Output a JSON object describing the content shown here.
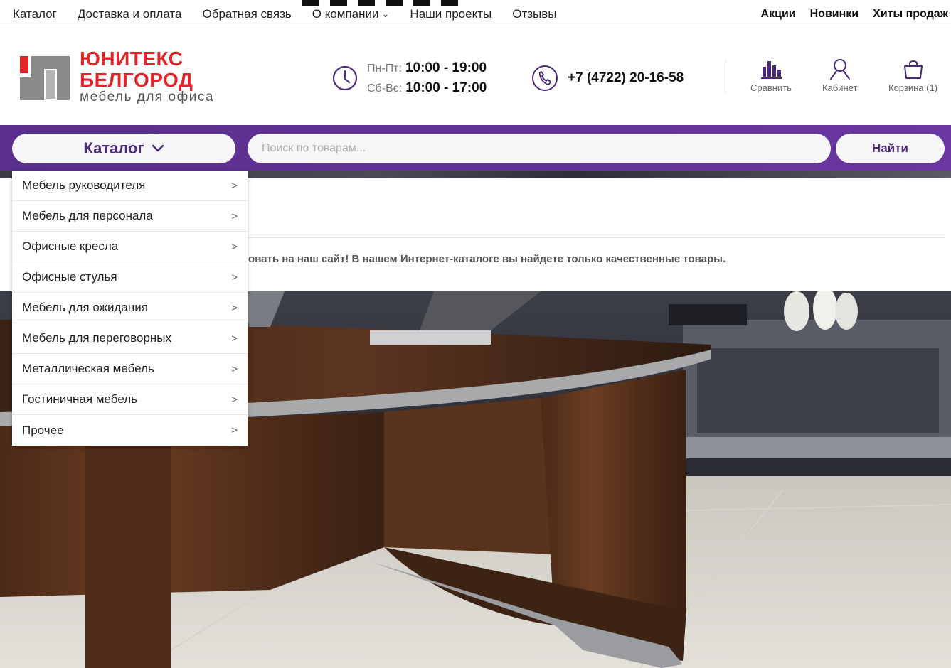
{
  "topnav": {
    "left": [
      {
        "label": "Каталог"
      },
      {
        "label": "Доставка и оплата"
      },
      {
        "label": "Обратная связь"
      },
      {
        "label": "О компании",
        "has_dropdown": true
      },
      {
        "label": "Наши проекты"
      },
      {
        "label": "Отзывы"
      }
    ],
    "right": [
      {
        "label": "Акции"
      },
      {
        "label": "Новинки"
      },
      {
        "label": "Хиты продаж"
      }
    ]
  },
  "logo": {
    "line1": "ЮНИТЕКС",
    "line2": "БЕЛГОРОД",
    "tagline": "мебель для офиса"
  },
  "hours": {
    "weekdays_label": "Пн-Пт:",
    "weekdays_value": "10:00 - 19:00",
    "weekend_label": "Сб-Вс:",
    "weekend_value": "10:00 - 17:00"
  },
  "phone": "+7 (4722) 20-16-58",
  "header_icons": {
    "compare": "Сравнить",
    "cabinet": "Кабинет",
    "cart": "Корзина (1)"
  },
  "catalog_button": "Каталог",
  "search": {
    "placeholder": "Поиск по товарам...",
    "button": "Найти"
  },
  "welcome_text": "овать на наш сайт! В нашем Интернет-каталоге вы найдете только качественные товары.",
  "catalog_menu": [
    "Мебель руководителя",
    "Мебель для персонала",
    "Офисные кресла",
    "Офисные стулья",
    "Мебель для ожидания",
    "Мебель для переговорных",
    "Металлическая мебель",
    "Гостиничная мебель",
    "Прочее"
  ],
  "colors": {
    "brand_red": "#e0262b",
    "brand_purple": "#5a2f8e",
    "logo_gray": "#8a8a8a"
  }
}
